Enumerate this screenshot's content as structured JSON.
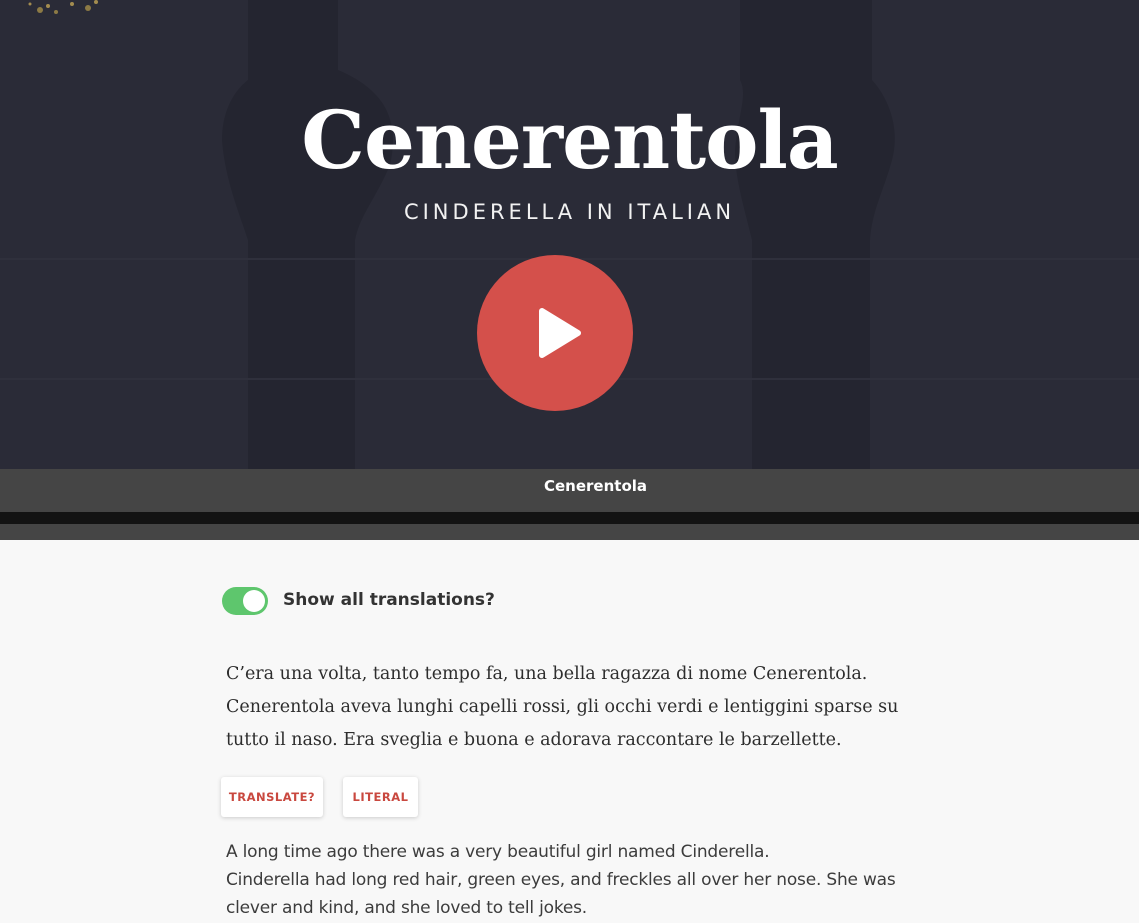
{
  "hero": {
    "title": "Cenerentola",
    "subtitle": "CINDERELLA IN ITALIAN",
    "play_icon": "play-icon",
    "accent_color": "#d4504b"
  },
  "bar": {
    "title": "Cenerentola"
  },
  "toggle": {
    "label": "Show all translations?",
    "on": true,
    "color": "#5ec66d"
  },
  "story": {
    "italian": "C’era una volta, tanto tempo fa, una bella ragazza di nome Cenerentola. Cenerentola aveva lunghi capelli rossi, gli occhi verdi e lentiggini sparse su tutto il naso. Era sveglia e buona e adorava raccontare le barzellette.",
    "buttons": {
      "translate": "TRANSLATE?",
      "literal": "LITERAL"
    },
    "english_lines": [
      "A long time ago there was a very beautiful girl named Cinderella.",
      "Cinderella had long red hair, green eyes, and freckles all over her nose. She was",
      "clever and kind, and she loved to tell jokes."
    ]
  }
}
